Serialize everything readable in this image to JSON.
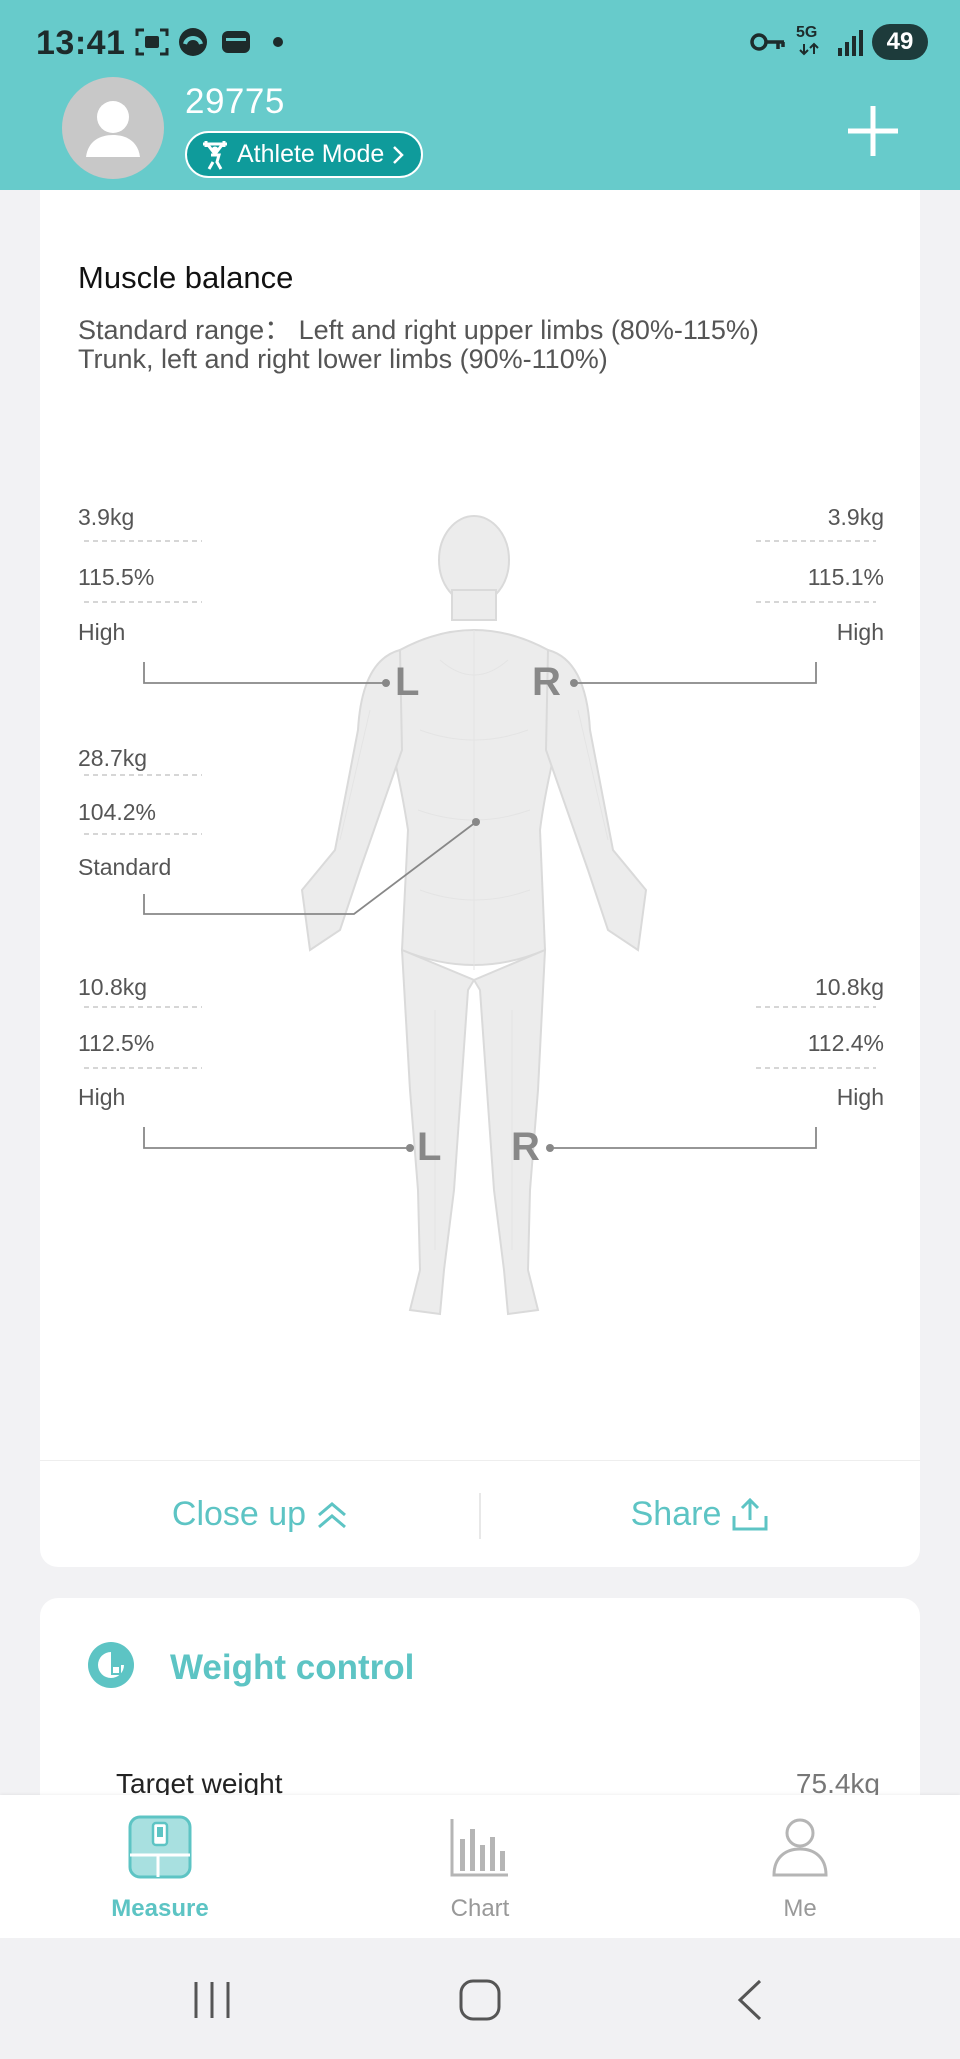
{
  "status_bar": {
    "time": "13:41",
    "network": "5G",
    "battery": "49"
  },
  "header": {
    "user_id": "29775",
    "mode_label": "Athlete Mode"
  },
  "muscle_balance": {
    "title": "Muscle balance",
    "subtitle_line1": "Standard range： Left and right upper limbs (80%-115%)",
    "subtitle_line2": "Trunk, left and right lower limbs (90%-110%)",
    "side_left": "L",
    "side_right": "R",
    "left_arm": {
      "mass": "3.9kg",
      "percent": "115.5%",
      "status": "High"
    },
    "right_arm": {
      "mass": "3.9kg",
      "percent": "115.1%",
      "status": "High"
    },
    "trunk": {
      "mass": "28.7kg",
      "percent": "104.2%",
      "status": "Standard"
    },
    "left_leg": {
      "mass": "10.8kg",
      "percent": "112.5%",
      "status": "High"
    },
    "right_leg": {
      "mass": "10.8kg",
      "percent": "112.4%",
      "status": "High"
    }
  },
  "card_actions": {
    "close_up": "Close up",
    "share": "Share"
  },
  "weight_control": {
    "title": "Weight control",
    "target_weight_label": "Target weight",
    "target_weight_value": "75.4kg"
  },
  "tabs": [
    {
      "label": "Measure",
      "active": true
    },
    {
      "label": "Chart",
      "active": false
    },
    {
      "label": "Me",
      "active": false
    }
  ],
  "colors": {
    "accent": "#5dc4c4",
    "header": "#67cbcb",
    "pill": "#0f9b9b"
  }
}
